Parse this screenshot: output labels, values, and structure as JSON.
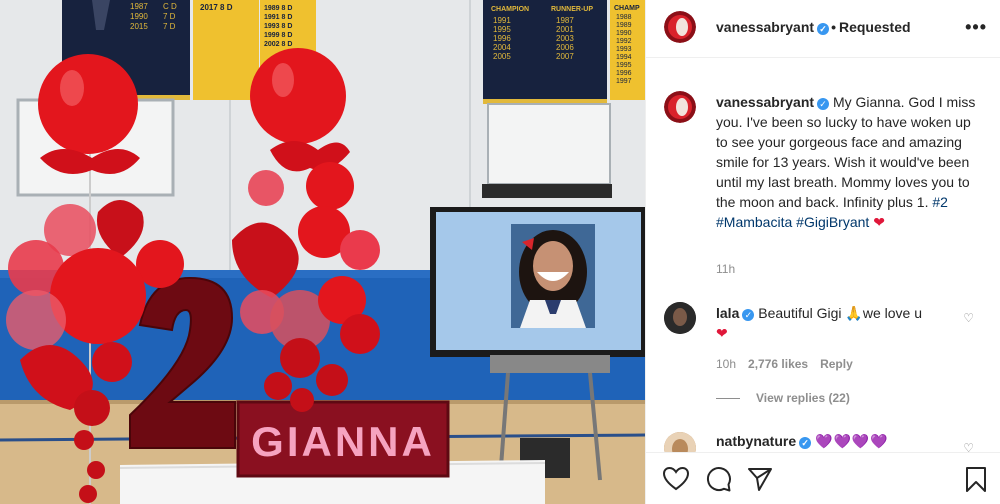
{
  "header": {
    "username": "vanessabryant",
    "separator": "•",
    "status": "Requested",
    "more_icon": "more-horizontal-icon"
  },
  "caption": {
    "username": "vanessabryant",
    "text": "My Gianna. God I miss you. I've been so lucky to have woken up to see your gorgeous face and amazing smile for 13 years. Wish it would've been until my last breath. Mommy loves you to the moon and back. Infinity plus 1. ",
    "tags": [
      "#2",
      "#Mambacita",
      "#GigiBryant"
    ],
    "time": "11h"
  },
  "comments": [
    {
      "username": "lala",
      "text": "Beautiful Gigi",
      "text_after": "we love u",
      "time": "10h",
      "likes": "2,776 likes",
      "reply": "Reply",
      "view_replies": "View replies (22)"
    },
    {
      "username": "natbynature",
      "emoji": "💜💜💜💜"
    }
  ],
  "photo": {
    "sign_text": "GIANNA",
    "banner_left": [
      [
        "1987",
        "C D"
      ],
      [
        "1990",
        "7 D"
      ],
      [
        "2015",
        "7 D"
      ]
    ],
    "banner_yellow_1": [
      "2017  8 D"
    ],
    "banner_yellow_2": [
      "1989  8 D",
      "1991  8 D",
      "1993  8 D",
      "1999  8 D",
      "2002  8 D"
    ],
    "banner_right": {
      "left_header": "CHAMPION",
      "right_header": "RUNNER-UP",
      "left": [
        "1991",
        "1995",
        "1996",
        "2004",
        "2005"
      ],
      "right": [
        "1987",
        "2001",
        "2003",
        "2006",
        "2007"
      ]
    },
    "banner_far_right": {
      "header": "CHAMP",
      "years": [
        "1988",
        "1989",
        "1990",
        "1992",
        "1993",
        "1994",
        "1995",
        "1996",
        "1997"
      ]
    }
  },
  "colors": {
    "verified": "#3897f0",
    "hashtag": "#00376b",
    "muted": "#8e8e8e",
    "balloon": "#e3161d"
  },
  "icons": {
    "like": "heart-outline-icon",
    "comment": "comment-bubble-icon",
    "share": "paper-plane-icon",
    "save": "bookmark-icon"
  }
}
